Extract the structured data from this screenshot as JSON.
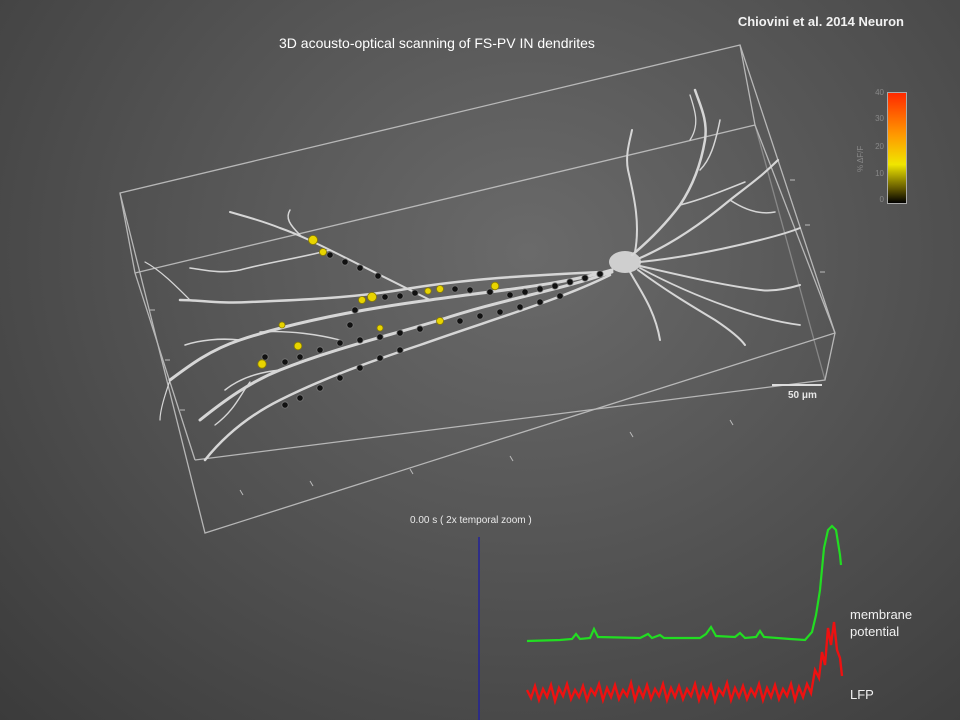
{
  "citation": "Chiovini et al. 2014 Neuron",
  "title": "3D acousto-optical scanning of FS-PV IN dendrites",
  "scale_bar": "50 μm",
  "time_label": "0.00 s ( 2x temporal zoom )",
  "colorbar": {
    "axis_label": "% ΔF/F",
    "ticks": [
      "40",
      "30",
      "20",
      "10",
      "0"
    ]
  },
  "traces": {
    "membrane": "membrane\npotential",
    "lfp": "LFP"
  },
  "colors": {
    "membrane_trace": "#22dd22",
    "lfp_trace": "#ee1111",
    "time_cursor": "#2222aa",
    "dendrite": "#d8d8d8"
  }
}
